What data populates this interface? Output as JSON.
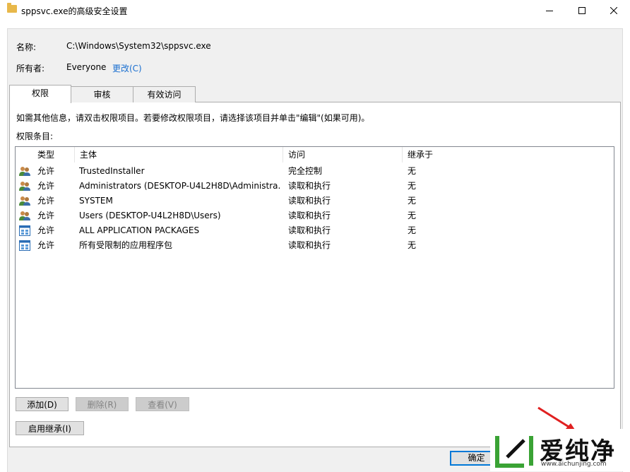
{
  "window": {
    "title": "sppsvc.exe的高级安全设置"
  },
  "info": {
    "name_label": "名称:",
    "name_value": "C:\\Windows\\System32\\sppsvc.exe",
    "owner_label": "所有者:",
    "owner_value": "Everyone",
    "owner_change": "更改(C)"
  },
  "tabs": [
    {
      "label": "权限",
      "active": true
    },
    {
      "label": "审核",
      "active": false
    },
    {
      "label": "有效访问",
      "active": false
    }
  ],
  "permissions": {
    "hint": "如需其他信息，请双击权限项目。若要修改权限项目，请选择该项目并单击\"编辑\"(如果可用)。",
    "entries_label": "权限条目:",
    "columns": [
      "类型",
      "主体",
      "访问",
      "继承于"
    ],
    "rows": [
      {
        "icon": "user-group-icon",
        "type": "允许",
        "principal": "TrustedInstaller",
        "access": "完全控制",
        "inherited": "无"
      },
      {
        "icon": "user-group-icon",
        "type": "允许",
        "principal": "Administrators (DESKTOP-U4L2H8D\\Administra...",
        "access": "读取和执行",
        "inherited": "无"
      },
      {
        "icon": "user-group-icon",
        "type": "允许",
        "principal": "SYSTEM",
        "access": "读取和执行",
        "inherited": "无"
      },
      {
        "icon": "user-group-icon",
        "type": "允许",
        "principal": "Users (DESKTOP-U4L2H8D\\Users)",
        "access": "读取和执行",
        "inherited": "无"
      },
      {
        "icon": "app-package-icon",
        "type": "允许",
        "principal": "ALL APPLICATION PACKAGES",
        "access": "读取和执行",
        "inherited": "无"
      },
      {
        "icon": "app-package-icon",
        "type": "允许",
        "principal": "所有受限制的应用程序包",
        "access": "读取和执行",
        "inherited": "无"
      }
    ]
  },
  "buttons": {
    "add": "添加(D)",
    "remove": "删除(R)",
    "view": "查看(V)",
    "enable_inheritance": "启用继承(I)",
    "ok": "确定"
  },
  "watermark": {
    "brand": "爱纯净",
    "url": "www.aichunjing.com"
  },
  "colors": {
    "accent": "#0078d7",
    "link": "#1a6fd0",
    "watermark_green": "#3aa335"
  }
}
